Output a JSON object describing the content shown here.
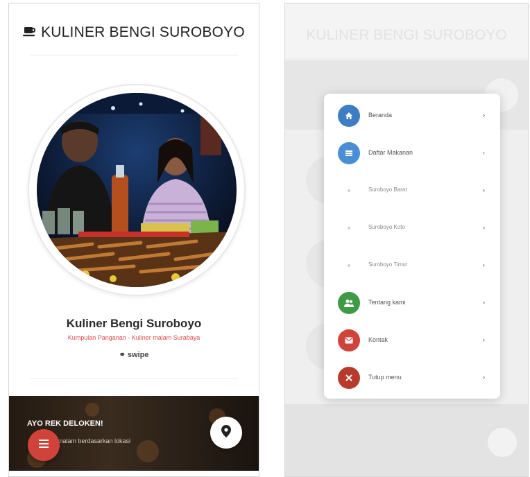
{
  "left": {
    "header": {
      "title": "KULINER BENGI SUROBOYO",
      "icon": "coffee-cup-icon"
    },
    "profile": {
      "name": "Kuliner Bengi Suroboyo",
      "tagline": "Kumpulan Panganan - Kuliner malam Surabaya",
      "swipe_label": "swipe",
      "photo_icon": "food-stall-photo"
    },
    "banner": {
      "title": "AYO REK DELOKEN!",
      "subtitle": "...er malam berdasarkan lokasi"
    },
    "fab_menu_icon": "hamburger-icon",
    "fab_location_icon": "map-pin-icon"
  },
  "right": {
    "header": {
      "title": "KULINER BENGI SUROBOYO"
    },
    "menu": [
      {
        "label": "Beranda",
        "icon": "home-icon",
        "color": "#3e7cc4",
        "arrow": "›",
        "arrow_color": "#444444",
        "type": "main"
      },
      {
        "label": "Daftar Makanan",
        "icon": "list-icon",
        "color": "#4a8fd6",
        "arrow": "‹",
        "arrow_color": "#d0433a",
        "type": "main"
      },
      {
        "label": "Suroboyo Barat",
        "icon": "",
        "color": "",
        "arrow": "›",
        "arrow_color": "#444444",
        "type": "sub"
      },
      {
        "label": "Suroboyo Koto",
        "icon": "",
        "color": "",
        "arrow": "›",
        "arrow_color": "#444444",
        "type": "sub"
      },
      {
        "label": "Suroboyo Timur",
        "icon": "",
        "color": "",
        "arrow": "›",
        "arrow_color": "#444444",
        "type": "sub"
      },
      {
        "label": "Tentang kami",
        "icon": "people-icon",
        "color": "#3f9a45",
        "arrow": "›",
        "arrow_color": "#444444",
        "type": "main"
      },
      {
        "label": "Kontak",
        "icon": "mail-icon",
        "color": "#d0433a",
        "arrow": "›",
        "arrow_color": "#444444",
        "type": "main"
      },
      {
        "label": "Tutup menu",
        "icon": "close-icon",
        "color": "#b83a2c",
        "arrow": "›",
        "arrow_color": "#444444",
        "type": "main"
      }
    ]
  },
  "colors": {
    "accent_red": "#d0433a",
    "tagline_red": "#e04a4a"
  }
}
